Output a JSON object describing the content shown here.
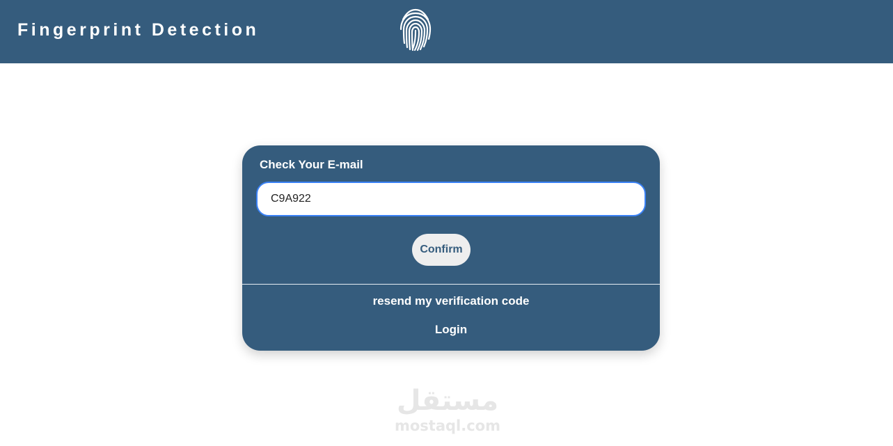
{
  "header": {
    "title": "Fingerprint Detection",
    "logo_icon": "fingerprint-icon",
    "background": "#355c7d"
  },
  "card": {
    "title": "Check Your E-mail",
    "code_input_value": "C9A922",
    "confirm_label": "Confirm",
    "resend_label": "resend my verification code",
    "login_label": "Login",
    "background": "#355c7d"
  },
  "watermark": {
    "arabic_text": "مستقل",
    "latin_text": "mostaql.com"
  }
}
